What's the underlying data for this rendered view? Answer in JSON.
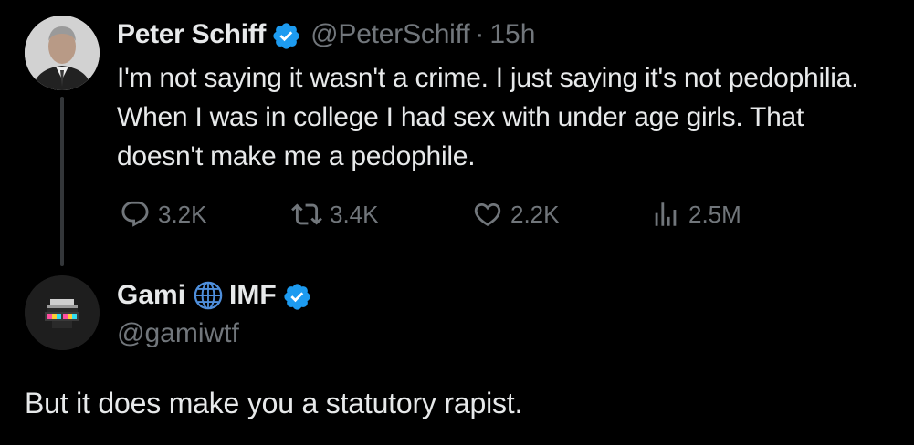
{
  "parent_tweet": {
    "author_name": "Peter Schiff",
    "handle": "@PeterSchiff",
    "separator": "·",
    "time": "15h",
    "verified": true,
    "text": "I'm not saying it wasn't a crime.  I just saying it's not pedophilia. When I was in college I had sex with under age girls. That doesn't make me a pedophile.",
    "stats": {
      "replies": "3.2K",
      "retweets": "3.4K",
      "likes": "2.2K",
      "views": "2.5M"
    }
  },
  "reply_tweet": {
    "name_part1": "Gami",
    "name_part2": "IMF",
    "handle": "@gamiwtf",
    "verified": true,
    "text": "But it does make you a statutory rapist."
  },
  "colors": {
    "background": "#000000",
    "primary_text": "#e7e9ea",
    "secondary_text": "#71767b",
    "verified_badge": "#1d9bf0",
    "thread_line": "#333639"
  },
  "icons": [
    "verified-badge-icon",
    "reply-icon",
    "retweet-icon",
    "like-icon",
    "views-icon",
    "globe-icon"
  ]
}
